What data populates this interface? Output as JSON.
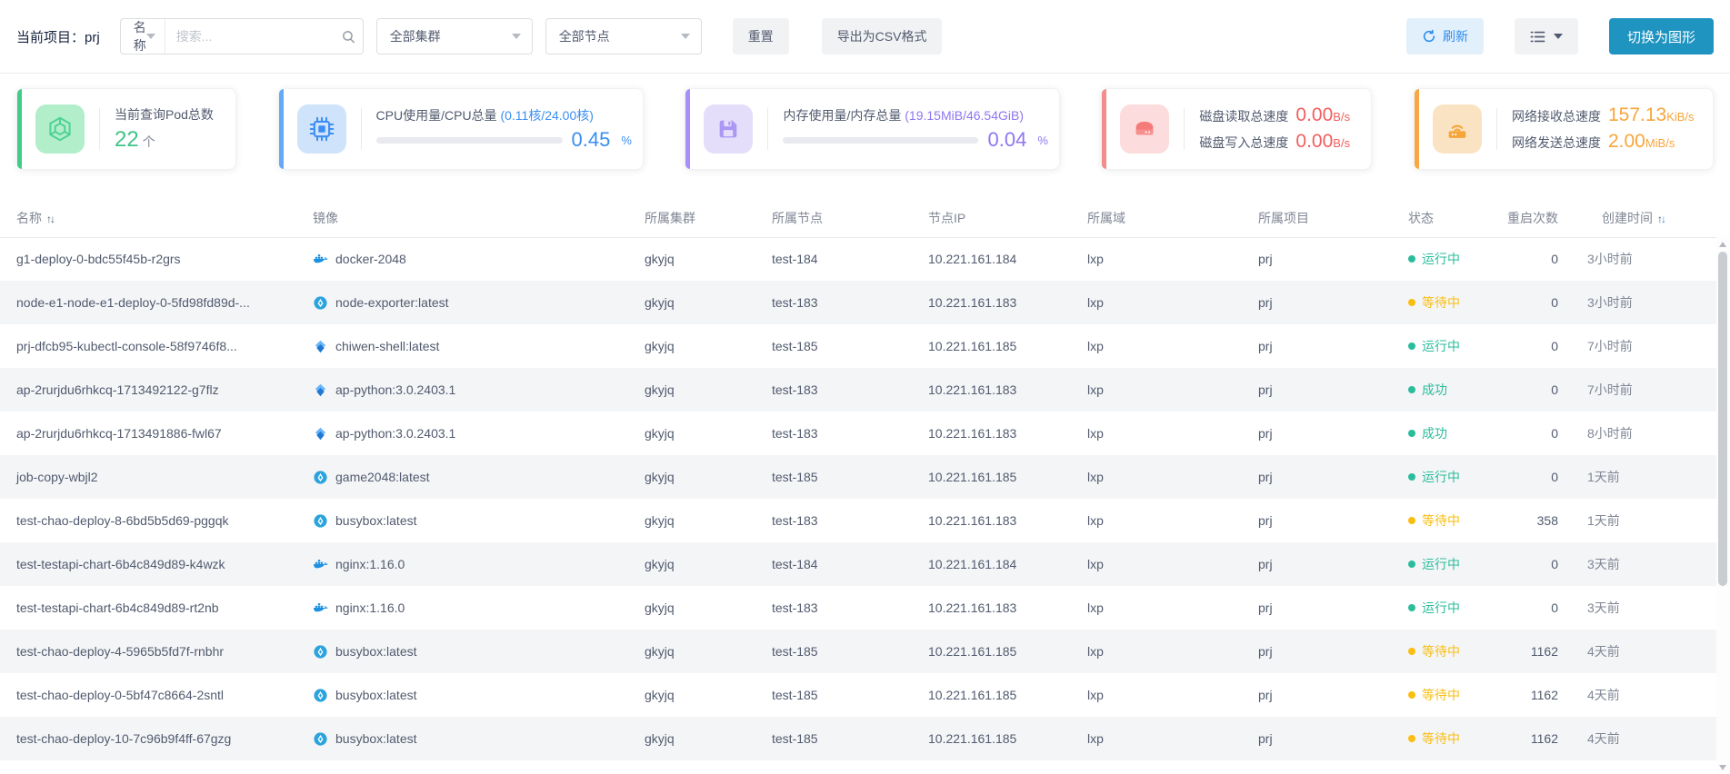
{
  "topbar": {
    "project_label": "当前项目：",
    "project_value": "prj",
    "name_filter": {
      "selected": "名称"
    },
    "search": {
      "placeholder": "搜索..."
    },
    "cluster_filter": {
      "selected": "全部集群"
    },
    "node_filter": {
      "selected": "全部节点"
    },
    "reset_button": "重置",
    "export_csv_button": "导出为CSV格式",
    "refresh_button": "刷新",
    "switch_to_chart_button": "切换为图形",
    "primary_color": "#2d8cf0",
    "switch_button_color": "#2094c1"
  },
  "cards": [
    {
      "key": "pod-count",
      "accent": "#42cd86",
      "icon_bg": "#b3eecb",
      "icon": "pod-hexagon-icon",
      "text_color": "#3ec588",
      "label": "当前查询Pod总数",
      "value": "22",
      "unit": "个"
    },
    {
      "key": "cpu",
      "accent": "#66a9f7",
      "icon_bg": "#cfe3fb",
      "icon": "cpu-chip-icon",
      "text_color": "#3a8ef0",
      "label": "CPU使用量/CPU总量",
      "paren": "(0.11核/24.00核)",
      "percent": "0.45",
      "percent_sign": "%"
    },
    {
      "key": "memory",
      "accent": "#a78ef8",
      "icon_bg": "#e4defa",
      "icon": "memory-floppy-icon",
      "text_color": "#8f75f2",
      "label": "内存使用量/内存总量",
      "paren": "(19.15MiB/46.54GiB)",
      "percent": "0.04",
      "percent_sign": "%"
    },
    {
      "key": "disk",
      "accent": "#f58c8c",
      "icon_bg": "#fcdcdc",
      "icon": "disk-drive-icon",
      "text_color": "#f25e5e",
      "lines": [
        {
          "label": "磁盘读取总速度",
          "value": "0.00",
          "unit": "B/s"
        },
        {
          "label": "磁盘写入总速度",
          "value": "0.00",
          "unit": "B/s"
        }
      ]
    },
    {
      "key": "network",
      "accent": "#f7a843",
      "icon_bg": "#fae3c2",
      "icon": "network-router-icon",
      "text_color": "#f7a53c",
      "lines": [
        {
          "label": "网络接收总速度",
          "value": "157.13",
          "unit": "KiB/s"
        },
        {
          "label": "网络发送总速度",
          "value": "2.00",
          "unit": "MiB/s"
        }
      ]
    }
  ],
  "status_colors": {
    "running": "#2bbd9b",
    "success": "#2bbd9b",
    "waiting": "#f9be11"
  },
  "table": {
    "columns": [
      {
        "key": "name",
        "label": "名称",
        "sort": "inactive"
      },
      {
        "key": "image",
        "label": "镜像"
      },
      {
        "key": "cluster",
        "label": "所属集群"
      },
      {
        "key": "node",
        "label": "所属节点"
      },
      {
        "key": "node-ip",
        "label": "节点IP"
      },
      {
        "key": "domain",
        "label": "所属域"
      },
      {
        "key": "project",
        "label": "所属项目"
      },
      {
        "key": "status",
        "label": "状态"
      },
      {
        "key": "restarts",
        "label": "重启次数"
      },
      {
        "key": "created",
        "label": "创建时间",
        "sort": "desc"
      }
    ],
    "rows": [
      {
        "name": "g1-deploy-0-bdc55f45b-r2grs",
        "image": "docker-2048",
        "icon": "docker-whale",
        "cluster": "gkyjq",
        "node": "test-184",
        "node_ip": "10.221.161.184",
        "domain": "lxp",
        "project": "prj",
        "status": "运行中",
        "status_key": "running",
        "restarts": "0",
        "created": "3小时前"
      },
      {
        "name": "node-e1-node-e1-deploy-0-5fd98fd89d-...",
        "image": "node-exporter:latest",
        "icon": "container-circle",
        "cluster": "gkyjq",
        "node": "test-183",
        "node_ip": "10.221.161.183",
        "domain": "lxp",
        "project": "prj",
        "status": "等待中",
        "status_key": "waiting",
        "restarts": "0",
        "created": "3小时前"
      },
      {
        "name": "prj-dfcb95-kubectl-console-58f9746f8...",
        "image": "chiwen-shell:latest",
        "icon": "gem-layers",
        "cluster": "gkyjq",
        "node": "test-185",
        "node_ip": "10.221.161.185",
        "domain": "lxp",
        "project": "prj",
        "status": "运行中",
        "status_key": "running",
        "restarts": "0",
        "created": "7小时前"
      },
      {
        "name": "ap-2rurjdu6rhkcq-1713492122-g7flz",
        "image": "ap-python:3.0.2403.1",
        "icon": "gem-layers",
        "cluster": "gkyjq",
        "node": "test-183",
        "node_ip": "10.221.161.183",
        "domain": "lxp",
        "project": "prj",
        "status": "成功",
        "status_key": "success",
        "restarts": "0",
        "created": "7小时前"
      },
      {
        "name": "ap-2rurjdu6rhkcq-1713491886-fwl67",
        "image": "ap-python:3.0.2403.1",
        "icon": "gem-layers",
        "cluster": "gkyjq",
        "node": "test-183",
        "node_ip": "10.221.161.183",
        "domain": "lxp",
        "project": "prj",
        "status": "成功",
        "status_key": "success",
        "restarts": "0",
        "created": "8小时前"
      },
      {
        "name": "job-copy-wbjl2",
        "image": "game2048:latest",
        "icon": "container-circle",
        "cluster": "gkyjq",
        "node": "test-185",
        "node_ip": "10.221.161.185",
        "domain": "lxp",
        "project": "prj",
        "status": "运行中",
        "status_key": "running",
        "restarts": "0",
        "created": "1天前"
      },
      {
        "name": "test-chao-deploy-8-6bd5b5d69-pggqk",
        "image": "busybox:latest",
        "icon": "container-circle",
        "cluster": "gkyjq",
        "node": "test-183",
        "node_ip": "10.221.161.183",
        "domain": "lxp",
        "project": "prj",
        "status": "等待中",
        "status_key": "waiting",
        "restarts": "358",
        "created": "1天前"
      },
      {
        "name": "test-testapi-chart-6b4c849d89-k4wzk",
        "image": "nginx:1.16.0",
        "icon": "docker-whale",
        "cluster": "gkyjq",
        "node": "test-184",
        "node_ip": "10.221.161.184",
        "domain": "lxp",
        "project": "prj",
        "status": "运行中",
        "status_key": "running",
        "restarts": "0",
        "created": "3天前"
      },
      {
        "name": "test-testapi-chart-6b4c849d89-rt2nb",
        "image": "nginx:1.16.0",
        "icon": "docker-whale",
        "cluster": "gkyjq",
        "node": "test-183",
        "node_ip": "10.221.161.183",
        "domain": "lxp",
        "project": "prj",
        "status": "运行中",
        "status_key": "running",
        "restarts": "0",
        "created": "3天前"
      },
      {
        "name": "test-chao-deploy-4-5965b5fd7f-rnbhr",
        "image": "busybox:latest",
        "icon": "container-circle",
        "cluster": "gkyjq",
        "node": "test-185",
        "node_ip": "10.221.161.185",
        "domain": "lxp",
        "project": "prj",
        "status": "等待中",
        "status_key": "waiting",
        "restarts": "1162",
        "created": "4天前"
      },
      {
        "name": "test-chao-deploy-0-5bf47c8664-2sntl",
        "image": "busybox:latest",
        "icon": "container-circle",
        "cluster": "gkyjq",
        "node": "test-185",
        "node_ip": "10.221.161.185",
        "domain": "lxp",
        "project": "prj",
        "status": "等待中",
        "status_key": "waiting",
        "restarts": "1162",
        "created": "4天前"
      },
      {
        "name": "test-chao-deploy-10-7c96b9f4ff-67gzg",
        "image": "busybox:latest",
        "icon": "container-circle",
        "cluster": "gkyjq",
        "node": "test-185",
        "node_ip": "10.221.161.185",
        "domain": "lxp",
        "project": "prj",
        "status": "等待中",
        "status_key": "waiting",
        "restarts": "1162",
        "created": "4天前"
      }
    ]
  }
}
